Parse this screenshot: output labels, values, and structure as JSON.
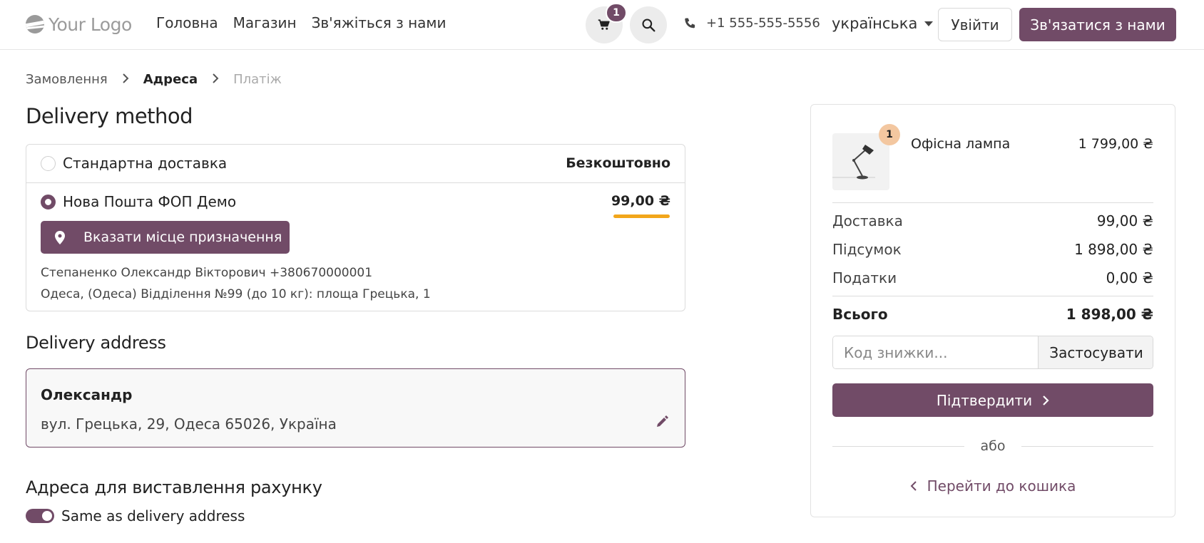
{
  "header": {
    "logo_text": "Your Logo",
    "nav": [
      "Головна",
      "Магазин",
      "Зв'яжіться з нами"
    ],
    "cart_count": "1",
    "phone": "+1 555-555-5556",
    "language": "українська",
    "login_label": "Увійти",
    "contact_label": "Зв'язатися з нами",
    "icons": {
      "cart": "cart-icon",
      "search": "search-icon",
      "phone": "phone-icon",
      "language": "chevron-down-icon"
    }
  },
  "breadcrumb": {
    "items": [
      "Замовлення",
      "Адреса",
      "Платіж"
    ],
    "active_index": 1
  },
  "delivery_method": {
    "title": "Delivery method",
    "options": [
      {
        "label": "Стандартна доставка",
        "price": "Безкоштовно",
        "selected": false
      },
      {
        "label": "Нова Пошта ФОП Демо",
        "price": "99,00 ₴",
        "selected": true
      }
    ],
    "destination_button": "Вказати місце призначення",
    "recipient_line": "Степаненко Олександр Вікторович +380670000001",
    "branch_line": "Одеса, (Одеса) Відділення №99 (до 10 кг): площа Грецька, 1"
  },
  "delivery_address": {
    "title": "Delivery address",
    "name": "Олександр",
    "address": "вул. Грецька, 29, Одеса 65026, Україна"
  },
  "billing": {
    "title": "Адреса для виставлення рахунку",
    "same_as_delivery_label": "Same as delivery address",
    "same_as_delivery": true
  },
  "summary": {
    "product": {
      "name": "Офісна лампа",
      "price": "1 799,00 ₴",
      "qty": "1"
    },
    "rows": [
      {
        "label": "Доставка",
        "value": "99,00 ₴"
      },
      {
        "label": "Підсумок",
        "value": "1 898,00 ₴"
      },
      {
        "label": "Податки",
        "value": "0,00 ₴"
      }
    ],
    "total_label": "Всього",
    "total_value": "1 898,00 ₴",
    "coupon_placeholder": "Код знижки...",
    "apply_label": "Застосувати",
    "confirm_label": "Підтвердити",
    "or_label": "або",
    "back_label": "Перейти до кошика"
  },
  "colors": {
    "brand": "#714b67",
    "accent_underline": "#f2a61b",
    "badge_peach": "#f3c7a0"
  }
}
